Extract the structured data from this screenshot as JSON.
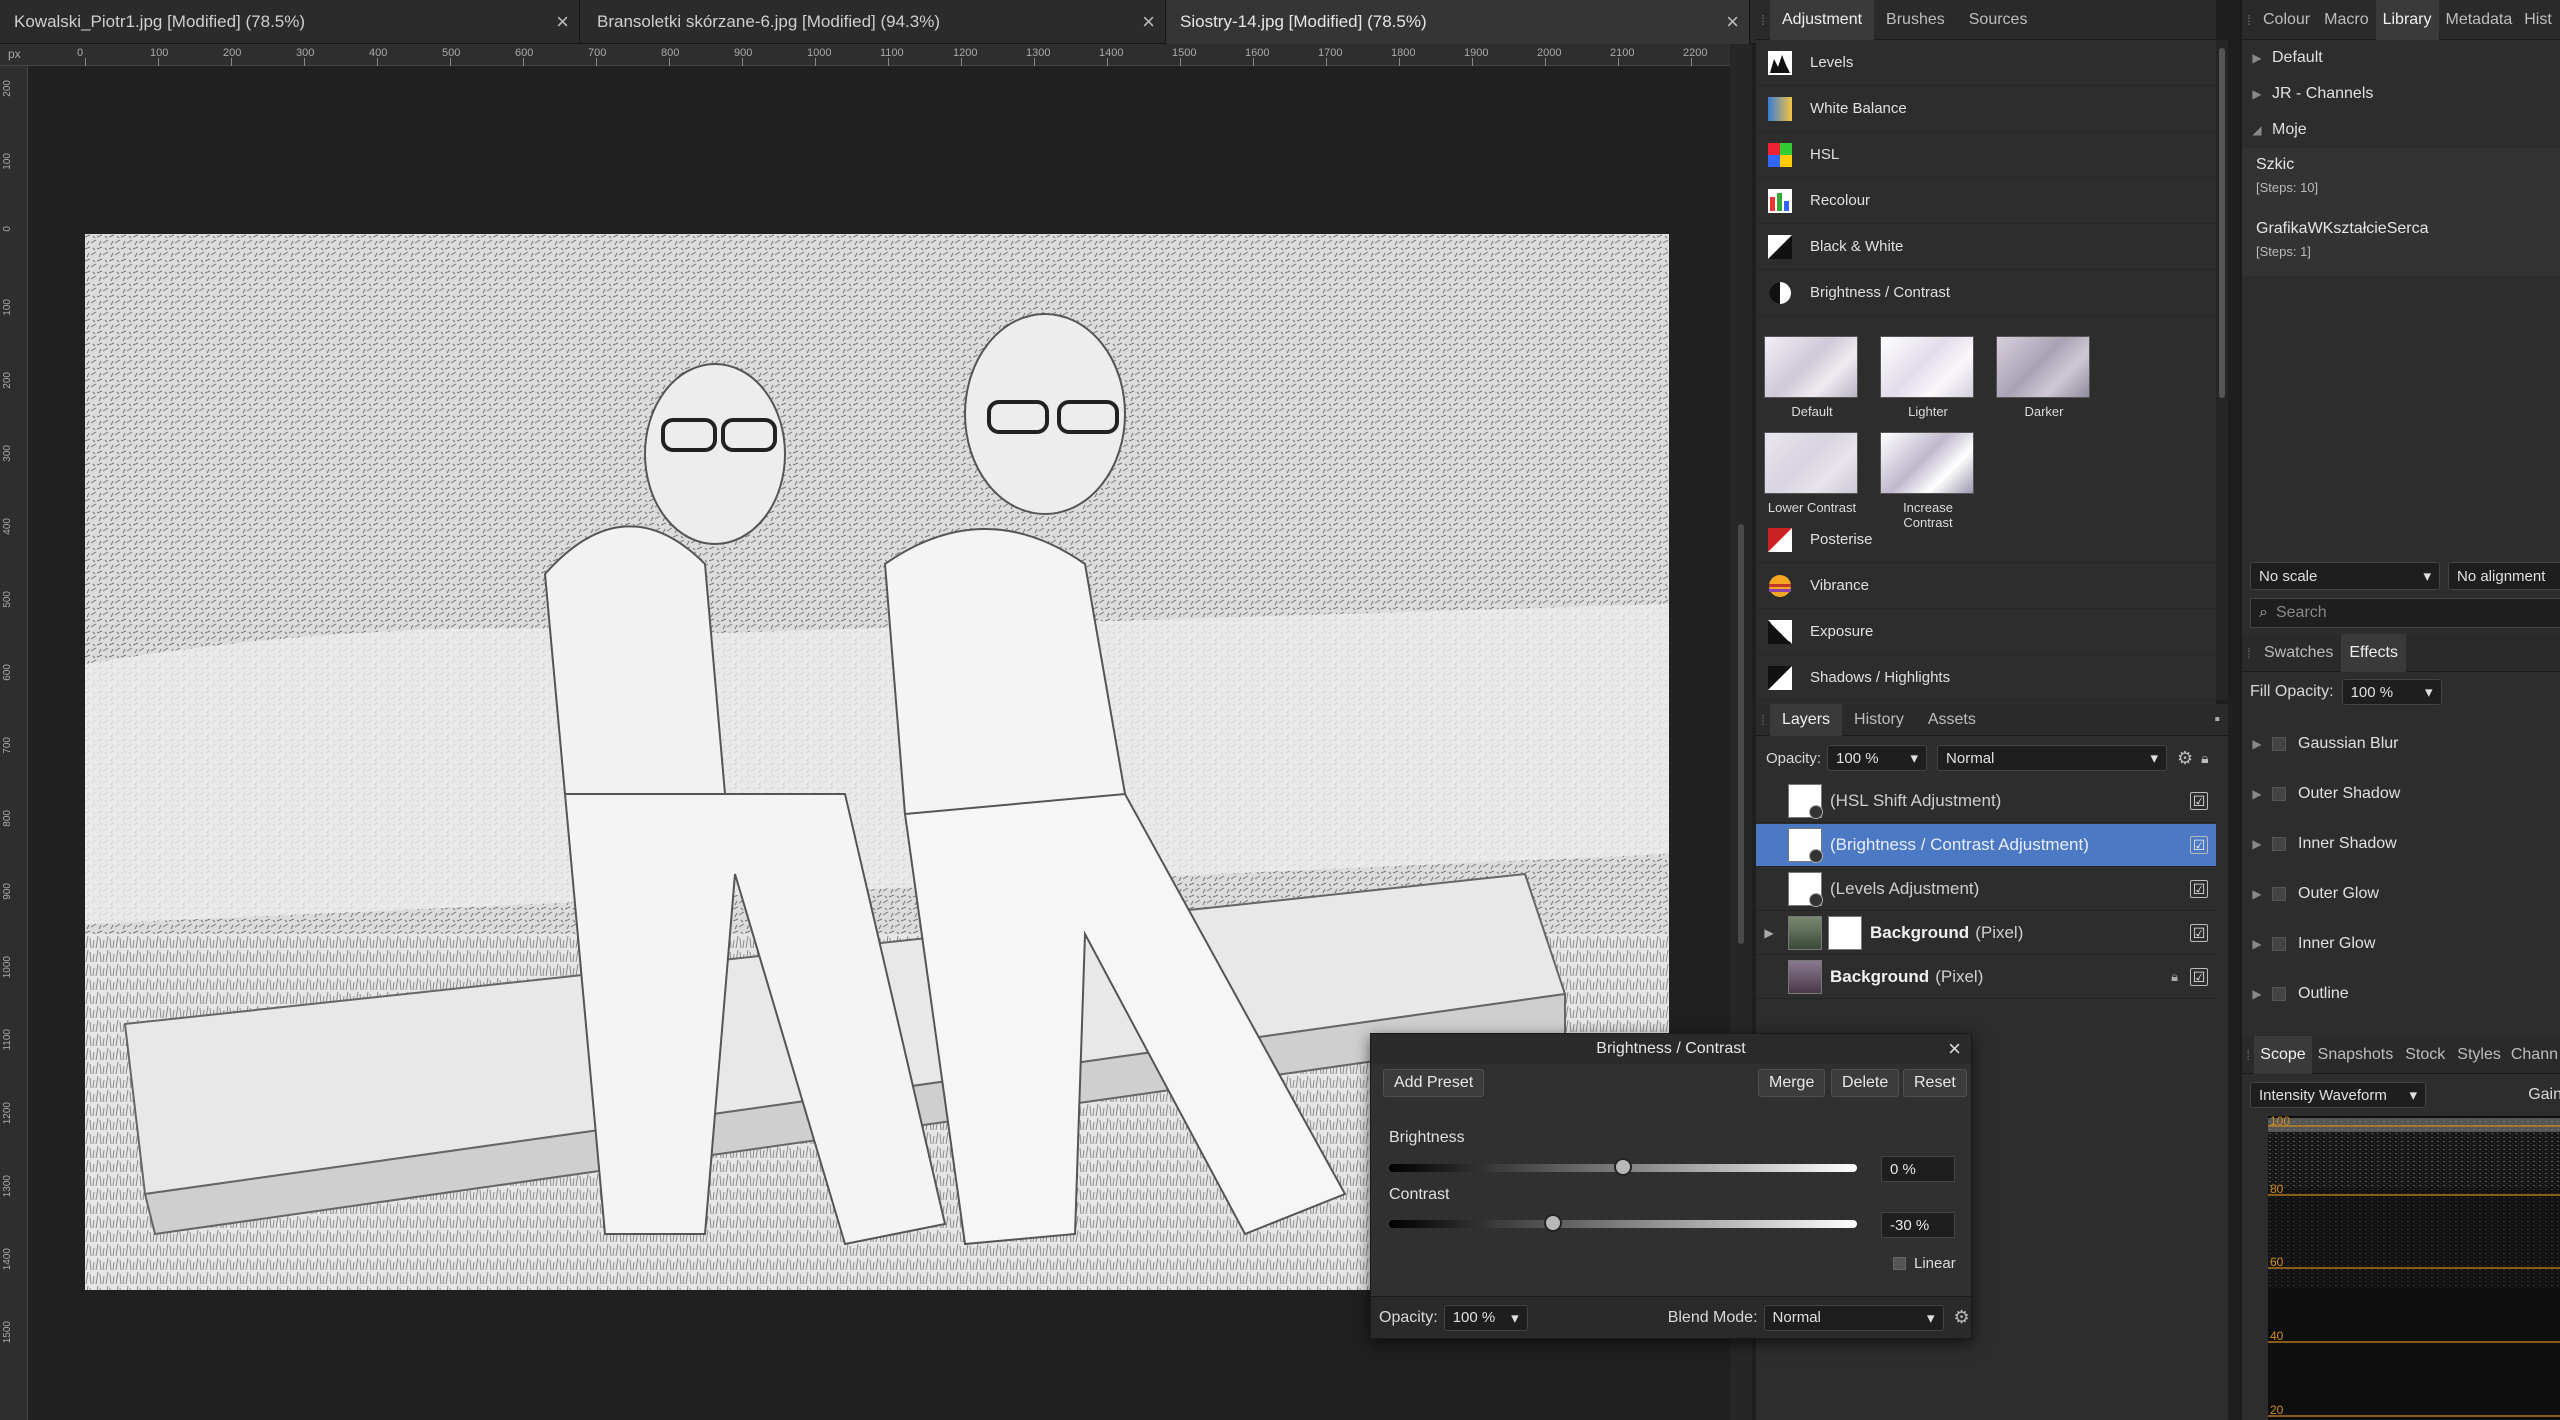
{
  "documents": [
    {
      "title": "Kowalski_Piotr1.jpg [Modified] (78.5%)"
    },
    {
      "title": "Bransoletki skórzane-6.jpg [Modified] (94.3%)"
    },
    {
      "title": "Siostry-14.jpg [Modified] (78.5%)"
    }
  ],
  "ruler": {
    "unit": "px",
    "top_ticks": [
      "0",
      "100",
      "200",
      "300",
      "400",
      "500",
      "600",
      "700",
      "800",
      "900",
      "1000",
      "1100",
      "1200",
      "1300",
      "1400",
      "1500",
      "1600",
      "1700",
      "1800",
      "1900",
      "2000",
      "2100",
      "2200"
    ],
    "left_ticks": [
      "200",
      "100",
      "0",
      "100",
      "200",
      "300",
      "400",
      "500",
      "600",
      "700",
      "800",
      "900",
      "1000",
      "1100",
      "1200",
      "1300",
      "1400",
      "1500"
    ]
  },
  "adjustment_panel": {
    "tabs": [
      "Adjustment",
      "Brushes",
      "Sources"
    ],
    "active_tab": "Adjustment",
    "items_top": [
      "Levels",
      "White Balance",
      "HSL",
      "Recolour",
      "Black & White",
      "Brightness / Contrast"
    ],
    "presets": [
      "Default",
      "Lighter",
      "Darker",
      "Lower Contrast",
      "Increase Contrast"
    ],
    "items_bottom": [
      "Posterise",
      "Vibrance",
      "Exposure",
      "Shadows / Highlights"
    ]
  },
  "layers_panel": {
    "tabs": [
      "Layers",
      "History",
      "Assets"
    ],
    "active_tab": "Layers",
    "opacity_label": "Opacity:",
    "opacity_value": "100 %",
    "blend_mode": "Normal",
    "layers": [
      {
        "name": "(HSL Shift Adjustment)",
        "suffix": "",
        "selected": false,
        "visible": "☑"
      },
      {
        "name": "(Brightness / Contrast Adjustment)",
        "suffix": "",
        "selected": true,
        "visible": "☑"
      },
      {
        "name": "(Levels Adjustment)",
        "suffix": "",
        "selected": false,
        "visible": "☑"
      },
      {
        "name": "Background",
        "suffix": "(Pixel)",
        "selected": false,
        "visible": "☑"
      },
      {
        "name": "Background",
        "suffix": "(Pixel)",
        "selected": false,
        "visible": "☑"
      }
    ]
  },
  "library_panel": {
    "tabs": [
      "Colour",
      "Macro",
      "Library",
      "Metadata",
      "Hist"
    ],
    "active_tab": "Library",
    "groups": [
      "Default",
      "JR - Channels",
      "Moje"
    ],
    "macros": [
      {
        "name": "Szkic",
        "steps": "[Steps: 10]"
      },
      {
        "name": "GrafikaWKształcieSerca",
        "steps": "[Steps: 1]"
      }
    ],
    "scale": "No scale",
    "alignment": "No alignment",
    "search_placeholder": "Search"
  },
  "effects_panel": {
    "tabs": [
      "Swatches",
      "Effects"
    ],
    "active_tab": "Effects",
    "fill_opacity_label": "Fill Opacity:",
    "fill_opacity_value": "100 %",
    "effects": [
      "Gaussian Blur",
      "Outer Shadow",
      "Inner Shadow",
      "Outer Glow",
      "Inner Glow",
      "Outline"
    ]
  },
  "scope_panel": {
    "tabs": [
      "Scope",
      "Snapshots",
      "Stock",
      "Styles",
      "Chann"
    ],
    "active_tab": "Scope",
    "mode": "Intensity Waveform",
    "gain_label": "Gain",
    "levels": [
      "100",
      "80",
      "60",
      "40",
      "20"
    ]
  },
  "bc_dialog": {
    "title": "Brightness / Contrast",
    "buttons": {
      "add_preset": "Add Preset",
      "merge": "Merge",
      "delete": "Delete",
      "reset": "Reset"
    },
    "brightness_label": "Brightness",
    "brightness_value": "0 %",
    "brightness_level": 0.5,
    "contrast_label": "Contrast",
    "contrast_value": "-30 %",
    "contrast_level": 0.35,
    "linear_label": "Linear",
    "opacity_label": "Opacity:",
    "opacity_value": "100 %",
    "blend_label": "Blend Mode:",
    "blend_value": "Normal"
  },
  "colors": {
    "selection": "#4b79c4",
    "panel": "#2d2d2d",
    "canvas": "#202020"
  }
}
